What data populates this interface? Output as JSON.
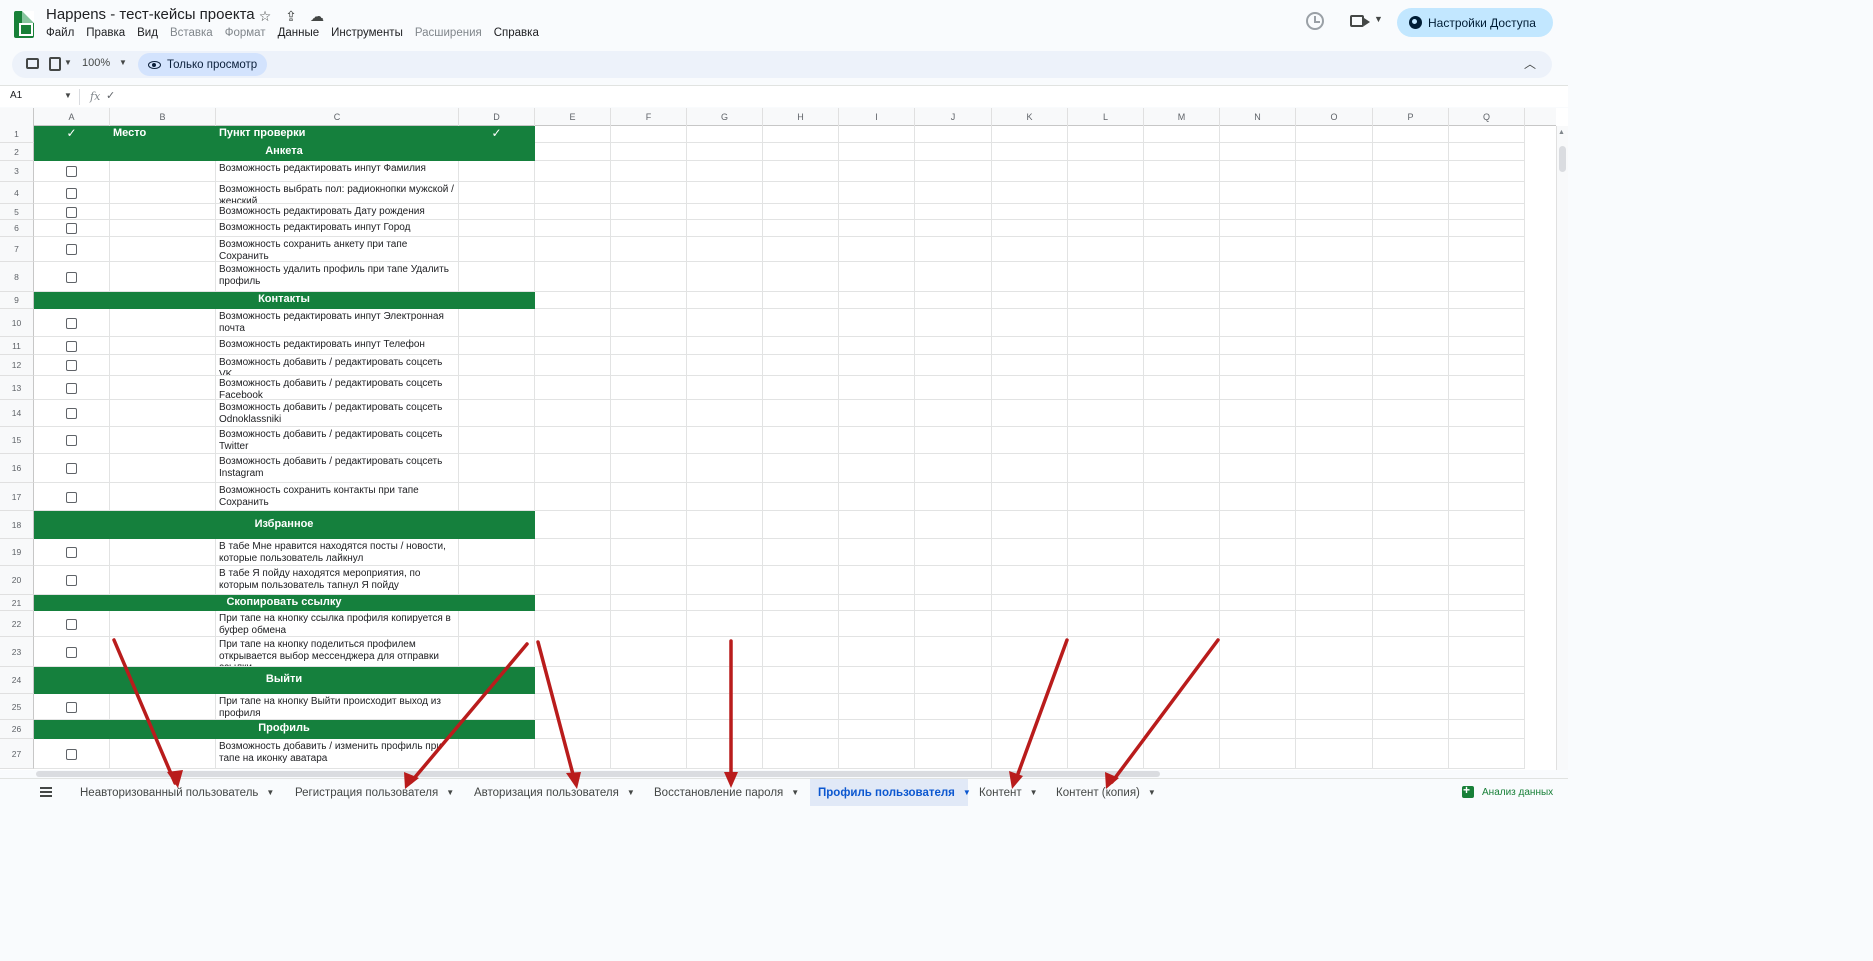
{
  "app": {
    "title": "Happens - тест-кейсы проекта",
    "menu": [
      {
        "label": "Файл",
        "enabled": true
      },
      {
        "label": "Правка",
        "enabled": true
      },
      {
        "label": "Вид",
        "enabled": true
      },
      {
        "label": "Вставка",
        "enabled": false
      },
      {
        "label": "Формат",
        "enabled": false
      },
      {
        "label": "Данные",
        "enabled": true
      },
      {
        "label": "Инструменты",
        "enabled": true
      },
      {
        "label": "Расширения",
        "enabled": false
      },
      {
        "label": "Справка",
        "enabled": true
      }
    ],
    "share_label": "Настройки Доступа",
    "title_icons": [
      "star-icon",
      "move-to-folder-icon",
      "cloud-status-icon"
    ]
  },
  "toolbar": {
    "zoom": "100%",
    "view_only_label": "Только просмотр"
  },
  "formula_bar": {
    "cell_ref": "A1",
    "fx_label": "fx",
    "value": "✓"
  },
  "columns": [
    "A",
    "B",
    "C",
    "D",
    "E",
    "F",
    "G",
    "H",
    "I",
    "J",
    "K",
    "L",
    "M",
    "N",
    "O",
    "P",
    "Q"
  ],
  "header_row": {
    "a": "✓",
    "b": "Место",
    "c": "Пункт проверки",
    "d": "✓"
  },
  "rows": [
    {
      "n": "2",
      "section": "Анкета"
    },
    {
      "n": "3",
      "c": "Возможность редактировать инпут Фамилия"
    },
    {
      "n": "4",
      "c": "Возможность выбрать пол: радиокнопки мужской / женский"
    },
    {
      "n": "5",
      "c": "Возможность редактировать Дату рождения"
    },
    {
      "n": "6",
      "c": "Возможность редактировать инпут Город"
    },
    {
      "n": "7",
      "c": "Возможность сохранить анкету при тапе Сохранить"
    },
    {
      "n": "8",
      "c": "Возможность удалить профиль при тапе Удалить профиль"
    },
    {
      "n": "9",
      "section": "Контакты"
    },
    {
      "n": "10",
      "c": "Возможность редактировать инпут Электронная почта"
    },
    {
      "n": "11",
      "c": "Возможность редактировать инпут Телефон"
    },
    {
      "n": "12",
      "c": "Возможность добавить / редактировать соцсеть VK"
    },
    {
      "n": "13",
      "c": "Возможность добавить / редактировать соцсеть Facebook"
    },
    {
      "n": "14",
      "c": "Возможность добавить / редактировать соцсеть Odnoklassniki"
    },
    {
      "n": "15",
      "c": "Возможность добавить / редактировать соцсеть Twitter"
    },
    {
      "n": "16",
      "c": "Возможность добавить / редактировать соцсеть Instagram"
    },
    {
      "n": "17",
      "c": "Возможность сохранить контакты при тапе Сохранить"
    },
    {
      "n": "18",
      "section": "Избранное"
    },
    {
      "n": "19",
      "c": "В табе Мне нравится находятся посты / новости, которые пользователь лайкнул"
    },
    {
      "n": "20",
      "c": "В табе Я пойду находятся мероприятия, по которым пользователь тапнул Я пойду"
    },
    {
      "n": "21",
      "section": "Скопировать ссылку"
    },
    {
      "n": "22",
      "c": "При тапе на кнопку ссылка профиля копируется в буфер обмена"
    },
    {
      "n": "23",
      "c": "При тапе на кнопку поделиться профилем открывается выбор мессенджера для отправки ссылки"
    },
    {
      "n": "24",
      "section": "Выйти"
    },
    {
      "n": "25",
      "c": "При тапе на кнопку Выйти происходит выход из профиля"
    },
    {
      "n": "26",
      "section": "Профиль"
    },
    {
      "n": "27",
      "c": "Возможность добавить / изменить профиль при тапе на иконку аватара"
    }
  ],
  "sheet_tabs": [
    {
      "label": "Неавторизованный пользователь",
      "active": false
    },
    {
      "label": "Регистрация пользователя",
      "active": false
    },
    {
      "label": "Авторизация пользователя",
      "active": false
    },
    {
      "label": "Восстановление пароля",
      "active": false
    },
    {
      "label": "Профиль пользователя",
      "active": true
    },
    {
      "label": "Контент",
      "active": false
    },
    {
      "label": "Контент (копия)",
      "active": false
    }
  ],
  "explore_label": "Анализ данных",
  "colors": {
    "section_green": "#15803d",
    "share_bg": "#c2e7ff",
    "active_tab": "#0b57d0",
    "arrow_red": "#b91c1c"
  }
}
